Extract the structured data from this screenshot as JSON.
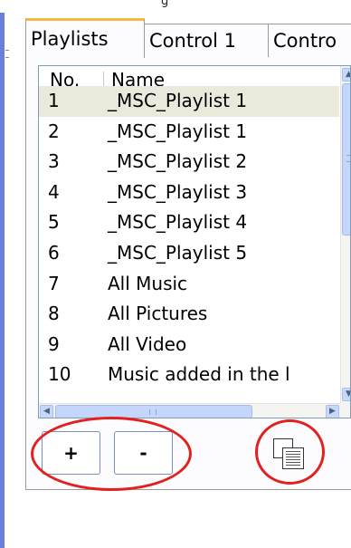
{
  "top_fragment": "g",
  "tabs": [
    {
      "label": "Playlists",
      "active": true
    },
    {
      "label": "Control 1",
      "active": false
    },
    {
      "label": "Contro",
      "active": false
    }
  ],
  "list": {
    "columns": {
      "no": "No.",
      "name": "Name"
    },
    "rows": [
      {
        "no": "1",
        "name": "_MSC_Playlist 1",
        "selected": true
      },
      {
        "no": "2",
        "name": "_MSC_Playlist 1"
      },
      {
        "no": "3",
        "name": "_MSC_Playlist 2"
      },
      {
        "no": "4",
        "name": "_MSC_Playlist 3"
      },
      {
        "no": "5",
        "name": "_MSC_Playlist 4"
      },
      {
        "no": "6",
        "name": "_MSC_Playlist 5"
      },
      {
        "no": "7",
        "name": "All Music"
      },
      {
        "no": "8",
        "name": "All Pictures"
      },
      {
        "no": "9",
        "name": "All Video"
      },
      {
        "no": "10",
        "name": "Music added in the l"
      }
    ]
  },
  "buttons": {
    "add_label": "+",
    "remove_label": "-",
    "copy_icon": "copy-icon"
  },
  "scrollbar_icons": {
    "up": "▲",
    "down": "▼",
    "left": "◀",
    "right": "▶"
  },
  "colors": {
    "accent_tab": "#f5b942",
    "selection": "#ebe8dc",
    "annotation": "#e22020",
    "edge": "#6a7fd6"
  }
}
